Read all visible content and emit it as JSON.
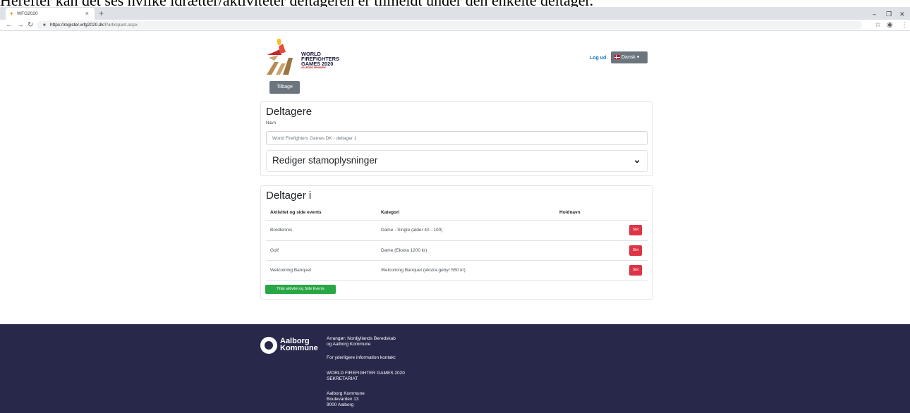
{
  "caption": "Herefter kan det ses hvilke idrætter/aktiviteter deltageren er tilmeldt under den enkelte deltager.",
  "browser": {
    "tab_title": "WFG2020",
    "url_host": "https://register.wfg2020.dk",
    "url_path": "/Participant.aspx"
  },
  "brand": {
    "line1": "WORLD",
    "line2": "FIREFIGHTERS",
    "line3": "GAMES 2020",
    "tagline": "AALBORG DENMARK"
  },
  "header": {
    "logout": "Log ud",
    "language": "Dansk",
    "back": "Tilbage"
  },
  "participants": {
    "title": "Deltagere",
    "name_label": "Navn",
    "name_value": "World Firefighters Games DK - deltager 1",
    "accordion_title": "Rediger stamoplysninger"
  },
  "participates": {
    "title": "Deltager i",
    "columns": [
      "Aktivitet og side events",
      "Kategori",
      "Holdnavn"
    ],
    "rows": [
      {
        "activity": "Bordtennis",
        "category": "Dame - Single (alder 40 - 100)",
        "team": "",
        "delete": "Slet"
      },
      {
        "activity": "Golf",
        "category": "Dame (Ekstra 1200 kr)",
        "team": "",
        "delete": "Slet"
      },
      {
        "activity": "Welcoming Banquet",
        "category": "Welcoming Banquet (ekstra gebyr 550 kr)",
        "team": "",
        "delete": "Slet"
      }
    ],
    "add_button": "Tilføj aktivitet og Side Events"
  },
  "footer": {
    "logo_line1": "Aalborg",
    "logo_line2": "Kommune",
    "organizer_line1": "Arrangør: Nordjyllands Beredskab",
    "organizer_line2": "og Aalborg Kommune",
    "contact_heading": "For yderligere information kontakt:",
    "secretariat_line1": "WORLD FIREFIGHTER GAMES 2020",
    "secretariat_line2": "SEKRETARIAT",
    "address_line1": "Aalborg Kommune",
    "address_line2": "Boulevarden 13",
    "address_line3": "9000 Aalborg"
  },
  "colors": {
    "footer_bg": "#27284a",
    "danger": "#dc3545",
    "success": "#28a745",
    "secondary": "#6c757d",
    "link": "#1479c4"
  }
}
